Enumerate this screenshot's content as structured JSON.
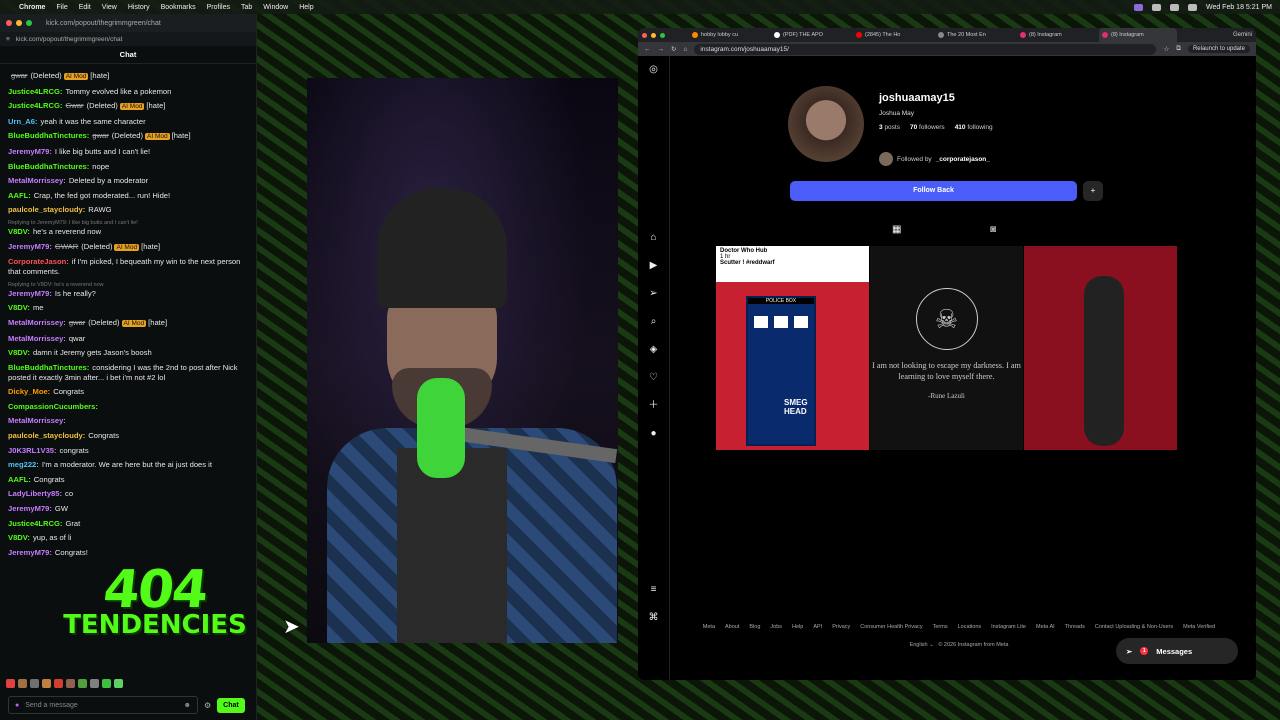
{
  "menubar": {
    "app": "Chrome",
    "items": [
      "File",
      "Edit",
      "View",
      "History",
      "Bookmarks",
      "Profiles",
      "Tab",
      "Window",
      "Help"
    ],
    "datetime": "Wed Feb 18  5:21 PM"
  },
  "kick": {
    "titlebar": "kick.com/popout/thegrimmgreen/chat",
    "address": "kick.com/popout/thegrimmgreen/chat",
    "header": "Chat",
    "input_placeholder": "Send a message",
    "chat_button": "Chat",
    "messages": [
      {
        "user": "",
        "text": "gwar",
        "extra": "(Deleted)",
        "tag": "AI Mod",
        "tail": "[hate]",
        "color": "g"
      },
      {
        "user": "Justice4LRCG:",
        "text": "Tommy evolved like a pokemon",
        "color": "g"
      },
      {
        "user": "Justice4LRCG:",
        "text": "Gwar",
        "extra": "(Deleted)",
        "tag": "AI Mod",
        "tail": "[hate]",
        "color": "g"
      },
      {
        "user": "Urn_A6:",
        "text": "yeah it was the same character",
        "color": "b"
      },
      {
        "user": "BlueBuddhaTinctures:",
        "text": "gwar",
        "extra": "(Deleted)",
        "tag": "AI Mod",
        "tail": "[hate]",
        "color": "g"
      },
      {
        "user": "JeremyM79:",
        "text": "I like big butts and I can't lie!",
        "color": "p"
      },
      {
        "user": "BlueBuddhaTinctures:",
        "text": "nope",
        "color": "g"
      },
      {
        "user": "MetalMorrissey:",
        "text": "Deleted by a moderator",
        "color": "p"
      },
      {
        "user": "AAFL:",
        "text": "Crap, the fed got moderated... run! Hide!",
        "color": "g"
      },
      {
        "user": "paulcole_staycloudy:",
        "text": "RAWG",
        "color": "y"
      },
      {
        "reply": "Replying to JeremyM79: I like big butts and I can't lie!",
        "user": "V8DV:",
        "text": "he's a reverend now",
        "color": "g"
      },
      {
        "user": "JeremyM79:",
        "text": "GWAR",
        "extra": "(Deleted)",
        "tag": "AI Mod",
        "tail": "[hate]",
        "color": "p"
      },
      {
        "user": "CorporateJason:",
        "text": "if I'm picked, I bequeath my win to the next person that comments.",
        "color": "rd"
      },
      {
        "reply": "Replying to V8DV: he's a reverend now",
        "user": "JeremyM79:",
        "text": "Is he really?",
        "color": "p"
      },
      {
        "user": "V8DV:",
        "text": "me",
        "color": "g"
      },
      {
        "user": "MetalMorrissey:",
        "text": "gwar",
        "extra": "(Deleted)",
        "tag": "AI Mod",
        "tail": "[hate]",
        "color": "p"
      },
      {
        "user": "MetalMorrissey:",
        "text": "qwar",
        "color": "p"
      },
      {
        "user": "V8DV:",
        "text": "damn it Jeremy gets Jason's boosh",
        "color": "g"
      },
      {
        "user": "BlueBuddhaTinctures:",
        "text": "considering I was the 2nd to post after Nick posted it exactly 3min after... i bet i'm not #2 lol",
        "color": "g"
      },
      {
        "user": "Dicky_Moe:",
        "text": "Congrats",
        "color": "o"
      },
      {
        "user": "CompassionCucumbers:",
        "text": "",
        "color": "g"
      },
      {
        "user": "MetalMorrissey:",
        "text": "",
        "color": "p"
      },
      {
        "user": "paulcole_staycloudy:",
        "text": "Congrats",
        "color": "y"
      },
      {
        "user": "J0K3RL1V35:",
        "text": "congrats",
        "color": "p"
      },
      {
        "user": "meg222:",
        "text": "I'm a moderator. We are here but the ai just does it",
        "color": "b"
      },
      {
        "user": "AAFL:",
        "text": "Congrats",
        "color": "g"
      },
      {
        "user": "LadyLiberty85:",
        "text": "co",
        "color": "p"
      },
      {
        "user": "JeremyM79:",
        "text": "GW",
        "color": "p"
      },
      {
        "user": "Justice4LRCG:",
        "text": "Grat",
        "color": "g"
      },
      {
        "user": "V8DV:",
        "text": "yup, as of li",
        "color": "g"
      },
      {
        "user": "JeremyM79:",
        "text": "Congrats!",
        "color": "p"
      }
    ],
    "overlay_logo": {
      "line1": "404",
      "line2": "TENDENCIES"
    }
  },
  "chrome": {
    "tabs": [
      "hobby lobby cu",
      "(PDF) THE APO",
      "(2845) The Ho",
      "The 20 Most En",
      "(8) Instagram",
      "(8) Instagram"
    ],
    "gemini": "Gemini",
    "url": "instagram.com/joshuaamay15/",
    "relaunch": "Relaunch to update"
  },
  "instagram": {
    "username": "joshuaamay15",
    "fullname": "Joshua May",
    "posts": "3",
    "posts_label": "posts",
    "followers": "70",
    "followers_label": "followers",
    "following": "410",
    "following_label": "following",
    "followed_by_prefix": "Followed by",
    "followed_by": "_corporatejason_",
    "follow_button": "Follow Back",
    "post1": {
      "account": "Doctor Who Hub",
      "time": "1 hr",
      "caption": "Scutter ! #reddwarf",
      "sign": "SMEG HEAD",
      "box": "POLICE BOX"
    },
    "post2": {
      "quote": "I am not looking to escape my darkness. I am learning to love myself there.",
      "author": "-Rune Lazuli"
    },
    "footer": [
      "Meta",
      "About",
      "Blog",
      "Jobs",
      "Help",
      "API",
      "Privacy",
      "Consumer Health Privacy",
      "Terms",
      "Locations",
      "Instagram Lite",
      "Meta AI",
      "Threads",
      "Contact Uploading & Non-Users",
      "Meta Verified"
    ],
    "language": "English",
    "copyright": "© 2026 Instagram from Meta",
    "messages": "Messages",
    "badge": "1"
  },
  "colors": {
    "kick_green": "#53fc18",
    "ig_blue": "#4a5df9",
    "ai_mod": "#e8a020"
  }
}
